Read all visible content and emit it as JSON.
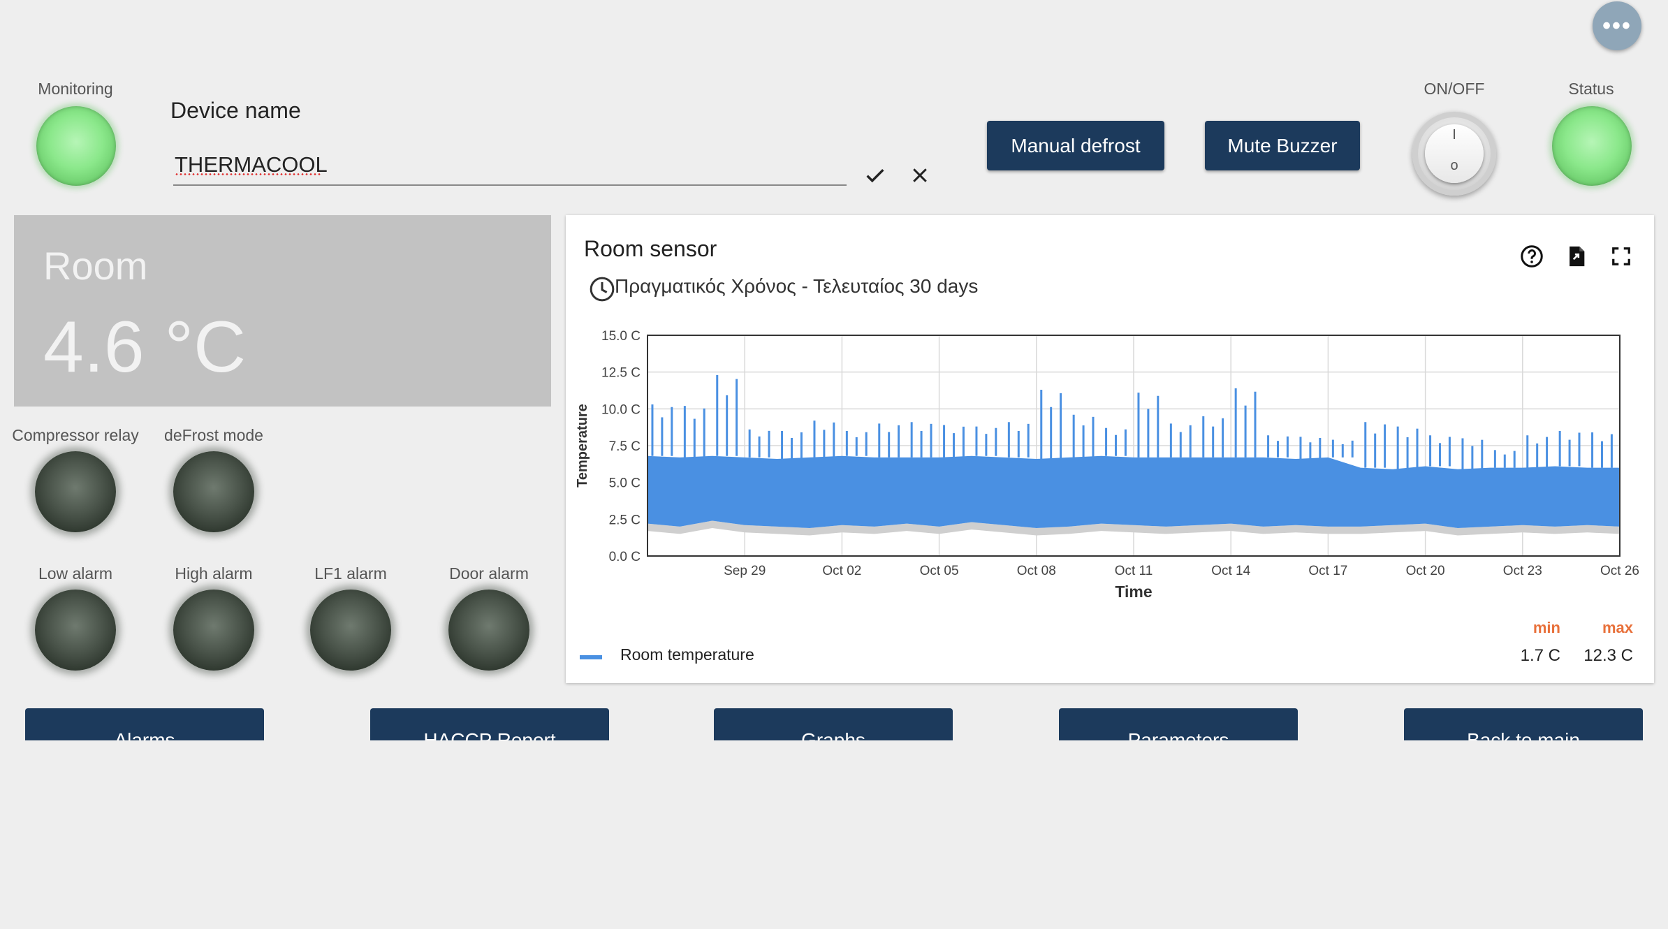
{
  "menu": {
    "more_label": "•••"
  },
  "monitoring": {
    "label": "Monitoring",
    "state": "on",
    "color": "#8be88b"
  },
  "device": {
    "label": "Device name",
    "value": "THERMACOOL"
  },
  "actions": {
    "manual_defrost": "Manual defrost",
    "mute_buzzer": "Mute Buzzer"
  },
  "power": {
    "label": "ON/OFF",
    "on_mark": "I",
    "off_mark": "o"
  },
  "status": {
    "label": "Status",
    "state": "on",
    "color": "#8be88b"
  },
  "room": {
    "title": "Room",
    "temperature": "4.6 °C"
  },
  "indicators": {
    "compressor_relay": "Compressor relay",
    "defrost_mode": "deFrost mode",
    "low_alarm": "Low alarm",
    "high_alarm": "High alarm",
    "lf1_alarm": "LF1 alarm",
    "door_alarm": "Door alarm"
  },
  "chart_card": {
    "title": "Room sensor",
    "subtitle": "Πραγματικός Χρόνος - Τελευταίος 30 days",
    "icons": [
      "help-icon",
      "export-file-icon",
      "fullscreen-icon"
    ]
  },
  "chart_data": {
    "type": "area",
    "title": "",
    "xlabel": "Time",
    "ylabel": "Temperature",
    "ylim": [
      0,
      15
    ],
    "yticks": [
      "0.0 C",
      "2.5 C",
      "5.0 C",
      "7.5 C",
      "10.0 C",
      "12.5 C",
      "15.0 C"
    ],
    "xticks": [
      "Sep 29",
      "Oct 02",
      "Oct 05",
      "Oct 08",
      "Oct 11",
      "Oct 14",
      "Oct 17",
      "Oct 20",
      "Oct 23",
      "Oct 26"
    ],
    "x_range": [
      "Sep 26",
      "Oct 26"
    ],
    "grid": true,
    "series": [
      {
        "name": "Room temperature",
        "color": "#4a90e2",
        "band_low": [
          2.2,
          2.0,
          2.4,
          2.1,
          2.0,
          1.9,
          2.1,
          2.0,
          2.2,
          2.0,
          2.3,
          2.1,
          1.9,
          2.0,
          2.2,
          2.1,
          2.0,
          2.1,
          2.2,
          2.0,
          2.1,
          2.0,
          2.0,
          2.1,
          2.2,
          1.9,
          2.0,
          2.1,
          2.0,
          2.1,
          2.0
        ],
        "band_high": [
          6.8,
          6.7,
          6.8,
          6.7,
          6.6,
          6.7,
          6.8,
          6.7,
          6.7,
          6.7,
          6.8,
          6.7,
          6.6,
          6.7,
          6.8,
          6.7,
          6.7,
          6.7,
          6.7,
          6.7,
          6.6,
          6.7,
          6.0,
          5.9,
          6.1,
          5.9,
          6.0,
          6.0,
          6.1,
          6.0,
          6.0
        ],
        "peaks": [
          {
            "x": "Sep 26",
            "y": 10.3
          },
          {
            "x": "Sep 27",
            "y": 10.2
          },
          {
            "x": "Sep 28",
            "y": 12.3
          },
          {
            "x": "Sep 29",
            "y": 8.6
          },
          {
            "x": "Sep 30",
            "y": 8.5
          },
          {
            "x": "Oct 01",
            "y": 9.2
          },
          {
            "x": "Oct 02",
            "y": 8.5
          },
          {
            "x": "Oct 03",
            "y": 9.0
          },
          {
            "x": "Oct 04",
            "y": 9.1
          },
          {
            "x": "Oct 05",
            "y": 8.9
          },
          {
            "x": "Oct 06",
            "y": 8.8
          },
          {
            "x": "Oct 07",
            "y": 9.1
          },
          {
            "x": "Oct 08",
            "y": 11.3
          },
          {
            "x": "Oct 09",
            "y": 9.6
          },
          {
            "x": "Oct 10",
            "y": 8.7
          },
          {
            "x": "Oct 11",
            "y": 11.1
          },
          {
            "x": "Oct 12",
            "y": 9.0
          },
          {
            "x": "Oct 13",
            "y": 9.5
          },
          {
            "x": "Oct 14",
            "y": 11.4
          },
          {
            "x": "Oct 15",
            "y": 8.2
          },
          {
            "x": "Oct 16",
            "y": 8.1
          },
          {
            "x": "Oct 17",
            "y": 7.9
          },
          {
            "x": "Oct 18",
            "y": 9.1
          },
          {
            "x": "Oct 19",
            "y": 8.8
          },
          {
            "x": "Oct 20",
            "y": 8.2
          },
          {
            "x": "Oct 21",
            "y": 8.0
          },
          {
            "x": "Oct 22",
            "y": 7.2
          },
          {
            "x": "Oct 23",
            "y": 8.2
          },
          {
            "x": "Oct 24",
            "y": 8.5
          },
          {
            "x": "Oct 25",
            "y": 8.4
          },
          {
            "x": "Oct 26",
            "y": 8.4
          }
        ],
        "min": "1.7 C",
        "max": "12.3 C"
      }
    ],
    "legend": "bottom-left"
  },
  "stats": {
    "min_label": "min",
    "max_label": "max",
    "min_value": "1.7 C",
    "max_value": "12.3 C"
  },
  "nav": {
    "alarms": "Alarms",
    "haccp": "HACCP Report",
    "graphs": "Graphs",
    "parameters": "Parameters",
    "back": "Back to main"
  }
}
